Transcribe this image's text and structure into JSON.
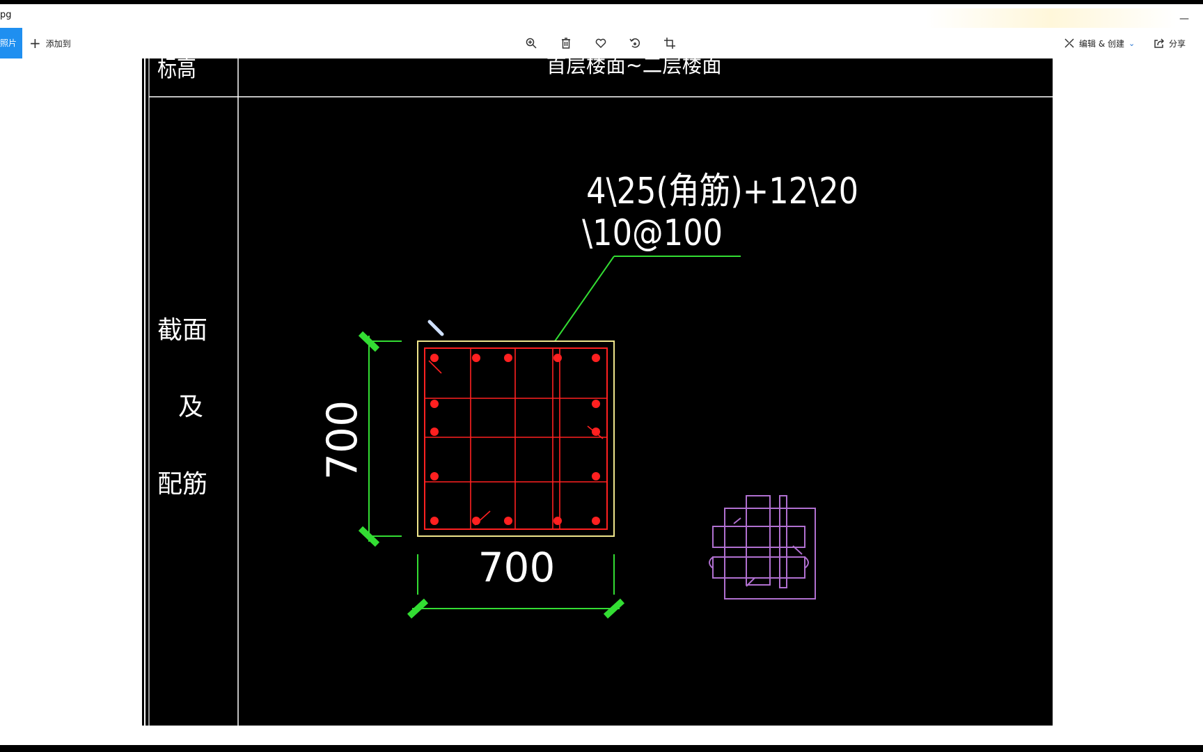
{
  "window": {
    "title_fragment": "pg",
    "minimize_label": "—"
  },
  "toolbar": {
    "photos_label": "照片",
    "add_to_label": "添加到",
    "icons": [
      "zoom-in-icon",
      "delete-icon",
      "favorite-icon",
      "rotate-icon",
      "crop-icon"
    ],
    "edit_create_label": "编辑 & 创建",
    "share_label": "分享"
  },
  "drawing": {
    "header_left": "标高",
    "header_right": "首层楼面~二层楼面",
    "row_label_1": "截面",
    "row_label_2": "及",
    "row_label_3": "配筋",
    "rebar_line_1": "4\\25(角筋)+12\\20",
    "rebar_line_2": "\\10@100",
    "dim_vertical": "700",
    "dim_horizontal": "700"
  },
  "colors": {
    "accent": "#1f8ff0",
    "cad_background": "#000000",
    "grid_lines": "#ffffff",
    "section_outline": "#f0e68c",
    "rebar": "#ff2020",
    "dimension": "#33dd33",
    "detail_symbol": "#b070d0"
  }
}
